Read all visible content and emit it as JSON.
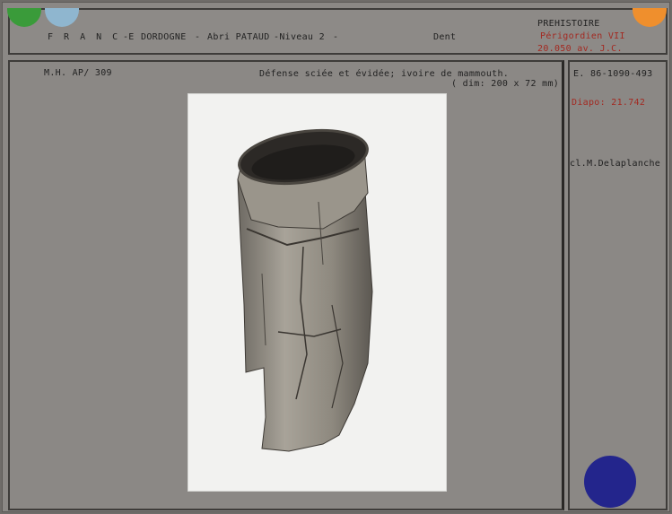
{
  "header": {
    "country": "F R A N C E",
    "dash1": "-",
    "region": "DORDOGNE",
    "dash2": "-",
    "site": "Abri PATAUD",
    "level": "-Niveau 2",
    "dash3": "-",
    "category": "Dent",
    "period": "PREHISTOIRE",
    "culture": "Périgordien VII",
    "date": "20.050 av. J.C."
  },
  "left": {
    "ref": "M.H. AP/ 309",
    "description": "Défense sciée et évidée; ivoire de mammouth.",
    "dimensions": "( dim: 200 x 72 mm)"
  },
  "right": {
    "inventory": "E. 86-1090-493",
    "slide": "Diapo: 21.742",
    "photographer": "cl.M.Delaplanche"
  },
  "colors": {
    "green_tab": "#3a9b3a",
    "blue_tab": "#8fb6cf",
    "orange_tab": "#ef8f2d",
    "blue_dot": "#23258c",
    "red_text": "#a32a22"
  },
  "photo": {
    "subject": "mammoth-tusk-artifact"
  }
}
